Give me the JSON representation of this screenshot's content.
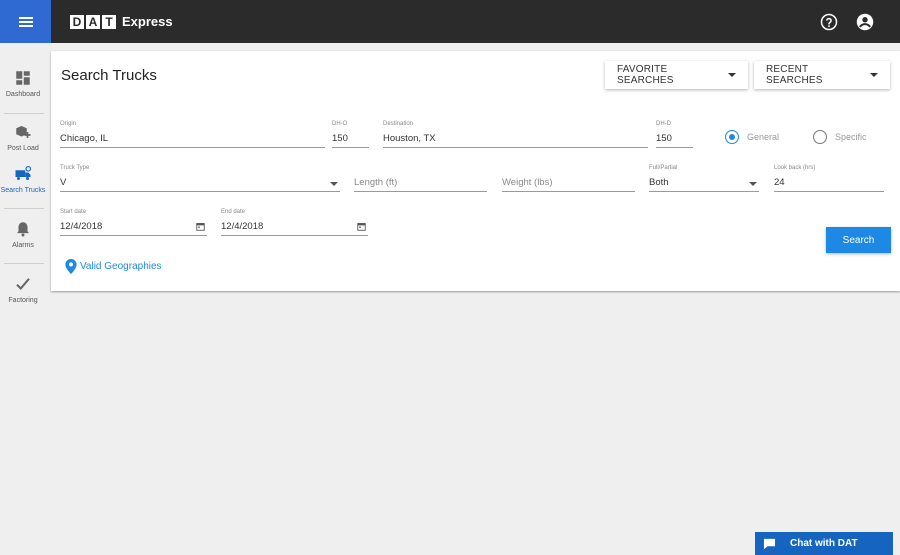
{
  "header": {
    "logo_letters": [
      "D",
      "A",
      "T"
    ],
    "product_name": "Express",
    "help_icon": "help-circle-icon",
    "account_icon": "account-circle-icon"
  },
  "sidebar": {
    "items": [
      {
        "label": "Dashboard",
        "icon": "dashboard-icon"
      },
      {
        "label": "Post Load",
        "icon": "post-load-icon"
      },
      {
        "label": "Search Trucks",
        "icon": "truck-icon",
        "active": true
      },
      {
        "label": "Alarms",
        "icon": "bell-icon"
      },
      {
        "label": "Factoring",
        "icon": "check-icon"
      }
    ]
  },
  "main": {
    "title": "Search Trucks",
    "favorite_searches_label": "FAVORITE SEARCHES",
    "recent_searches_label": "RECENT SEARCHES",
    "origin": {
      "label": "Origin",
      "value": "Chicago, IL"
    },
    "dh_o": {
      "label": "DH-O",
      "value": "150"
    },
    "destination": {
      "label": "Destination",
      "value": "Houston, TX"
    },
    "dh_d": {
      "label": "DH-D",
      "value": "150"
    },
    "radio_general": {
      "label": "General",
      "selected": true
    },
    "radio_specific": {
      "label": "Specific",
      "selected": false
    },
    "truck_type": {
      "label": "Truck Type",
      "value": "V"
    },
    "length": {
      "placeholder": "Length (ft)"
    },
    "weight": {
      "placeholder": "Weight (lbs)"
    },
    "full_partial": {
      "label": "Full/Partial",
      "value": "Both"
    },
    "look_back": {
      "label": "Look back (hrs)",
      "value": "24"
    },
    "start_date": {
      "label": "Start date",
      "value": "12/4/2018"
    },
    "end_date": {
      "label": "End date",
      "value": "12/4/2018"
    },
    "search_label": "Search",
    "valid_geographies_label": "Valid Geographies"
  },
  "chat": {
    "label": "Chat with DAT"
  },
  "colors": {
    "topbar": "#2b2b2b",
    "menu_button": "#2e6ad1",
    "accent": "#1e88e5",
    "chat": "#1565c0",
    "background": "#f0eff0"
  }
}
